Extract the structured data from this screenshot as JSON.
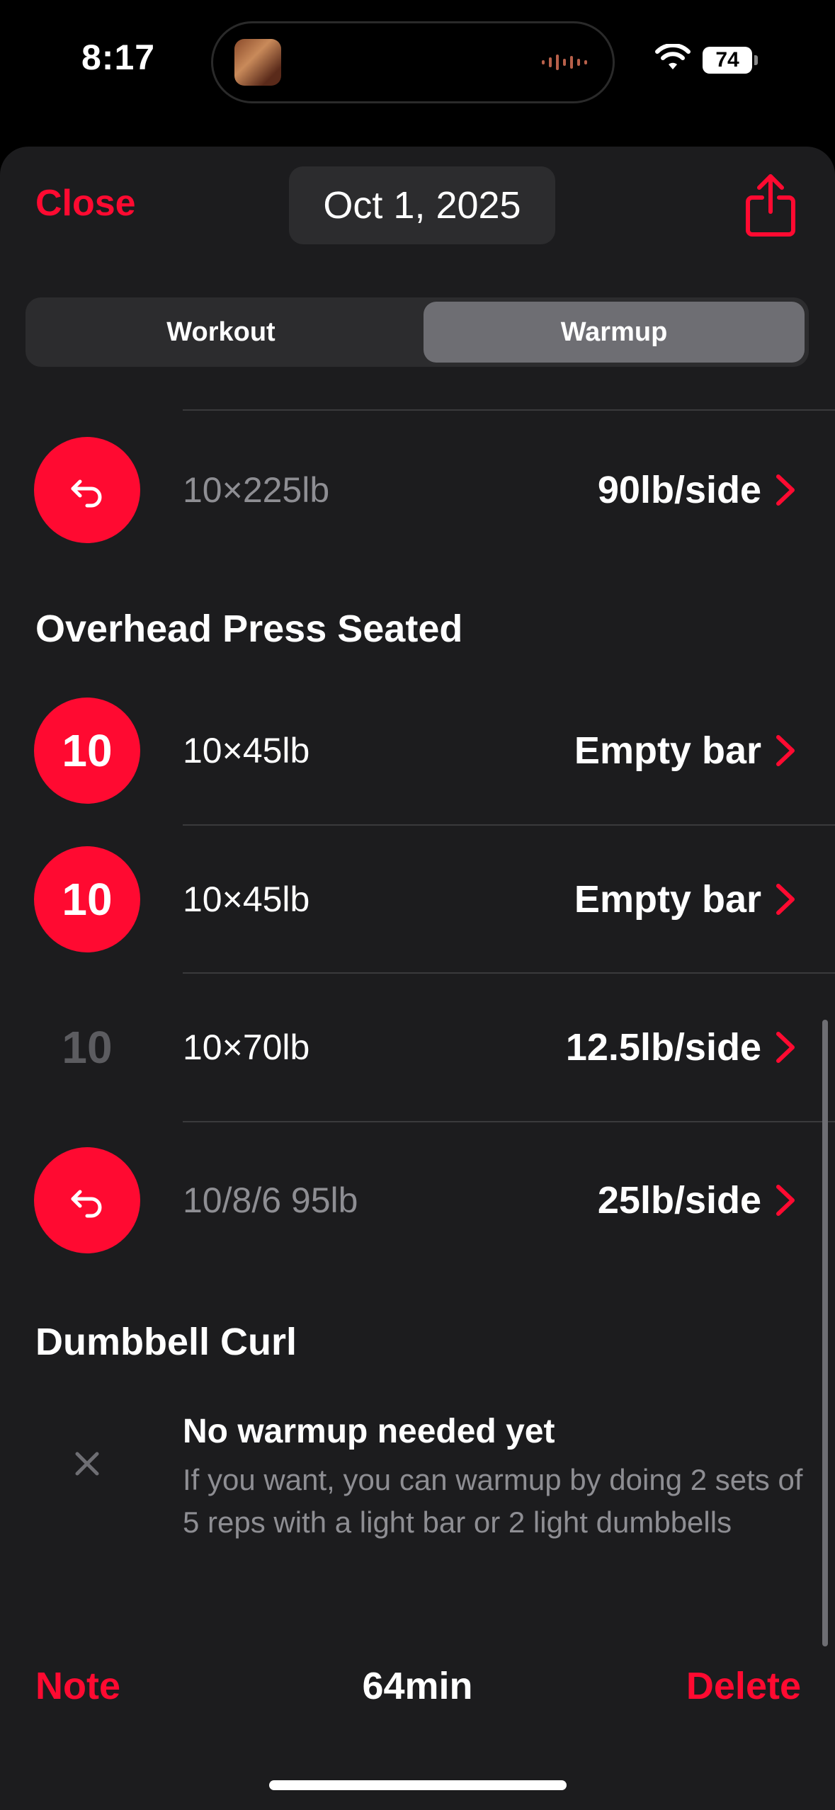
{
  "status_bar": {
    "time": "8:17",
    "battery": "74"
  },
  "header": {
    "close_label": "Close",
    "date": "Oct 1, 2025",
    "share_icon": "share-icon"
  },
  "tabs": [
    {
      "label": "Workout",
      "selected": false
    },
    {
      "label": "Warmup",
      "selected": true
    }
  ],
  "colors": {
    "accent": "#ff0a31",
    "background": "#1c1c1e",
    "muted": "#8e8e93"
  },
  "rows": [
    {
      "badge": "",
      "badge_icon": "undo-arrow-icon",
      "description": "10×225lb",
      "value": "90lb/side"
    }
  ],
  "sections": [
    {
      "title": "Overhead Press Seated",
      "rows": [
        {
          "badge": "10",
          "description": "10×45lb",
          "value": "Empty bar"
        },
        {
          "badge": "10",
          "description": "10×45lb",
          "value": "Empty bar"
        },
        {
          "badge": "10",
          "description": "10×70lb",
          "value": "12.5lb/side"
        },
        {
          "badge": "",
          "badge_icon": "undo-arrow-icon",
          "description": "10/8/6 95lb",
          "value": "25lb/side"
        }
      ]
    },
    {
      "title": "Dumbbell Curl",
      "empty_state": {
        "icon": "close-x-icon",
        "title": "No warmup needed yet",
        "body": "If you want, you can warmup by doing 2 sets of 5 reps with a light bar or 2 light dumbbells"
      }
    }
  ],
  "footer": {
    "note_label": "Note",
    "duration": "64min",
    "delete_label": "Delete"
  }
}
